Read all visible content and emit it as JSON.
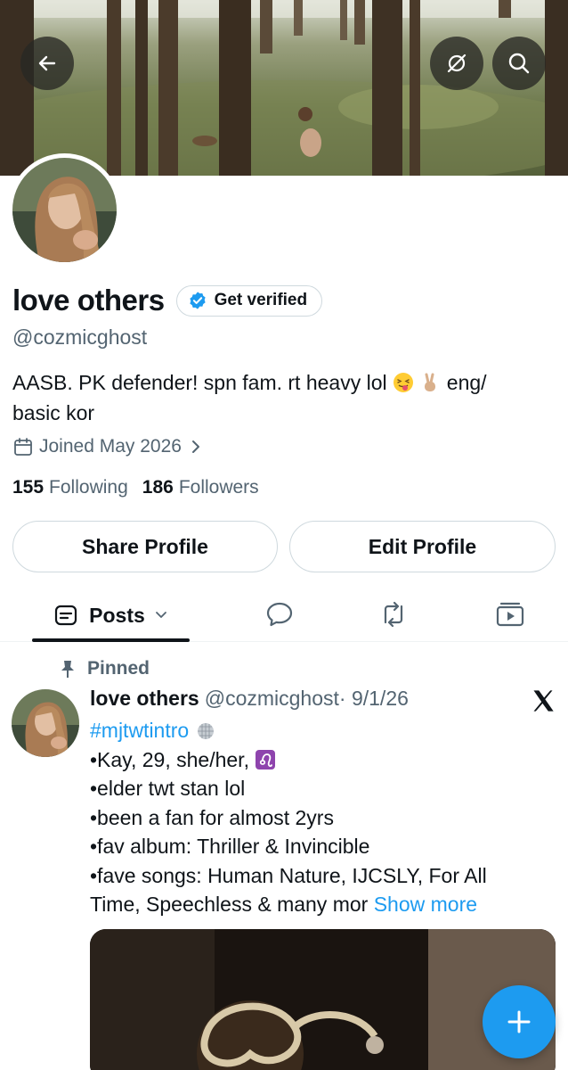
{
  "profile": {
    "display_name": "love others",
    "verify_label": "Get verified",
    "handle": "@cozmicghost",
    "bio_text": "AASB. PK defender! spn fam. rt heavy lol",
    "bio_text_after": "eng/",
    "bio_line2": "basic kor",
    "joined": "Joined May 2026",
    "following_count": "155",
    "following_label": "Following",
    "followers_count": "186",
    "followers_label": "Followers"
  },
  "actions": {
    "share_label": "Share Profile",
    "edit_label": "Edit Profile"
  },
  "tabs": {
    "posts_label": "Posts"
  },
  "post": {
    "pinned_label": "Pinned",
    "author_name": "love others",
    "author_handle": "@cozmicghost",
    "date": "· 9/1/26",
    "hashtag": "#mjtwtintro",
    "line1": "•Kay, 29, she/her,",
    "line2": "•elder twt stan lol",
    "line3": "•been a fan for almost 2yrs",
    "line4": "•fav album: Thriller & Invincible",
    "line5": "•fave songs: Human Nature, IJCSLY, For All",
    "line6": "Time, Speechless & many mor",
    "show_more": "Show more"
  },
  "icons": {
    "back": "back-arrow-icon",
    "btn_b": "circle-slash-icon",
    "btn_c": "search-icon",
    "verified": "verified-badge-icon",
    "calendar": "calendar-icon",
    "posts_tab": "posts-icon",
    "replies_tab": "speech-bubble-icon",
    "reposts_tab": "repost-icon",
    "media_tab": "media-icon",
    "pin": "pin-icon",
    "x_logo": "x-logo-icon",
    "compose": "plus-icon"
  },
  "colors": {
    "accent": "#1d9bf0",
    "text_primary": "#0f1419",
    "text_secondary": "#536471",
    "border": "#cfd9de"
  }
}
